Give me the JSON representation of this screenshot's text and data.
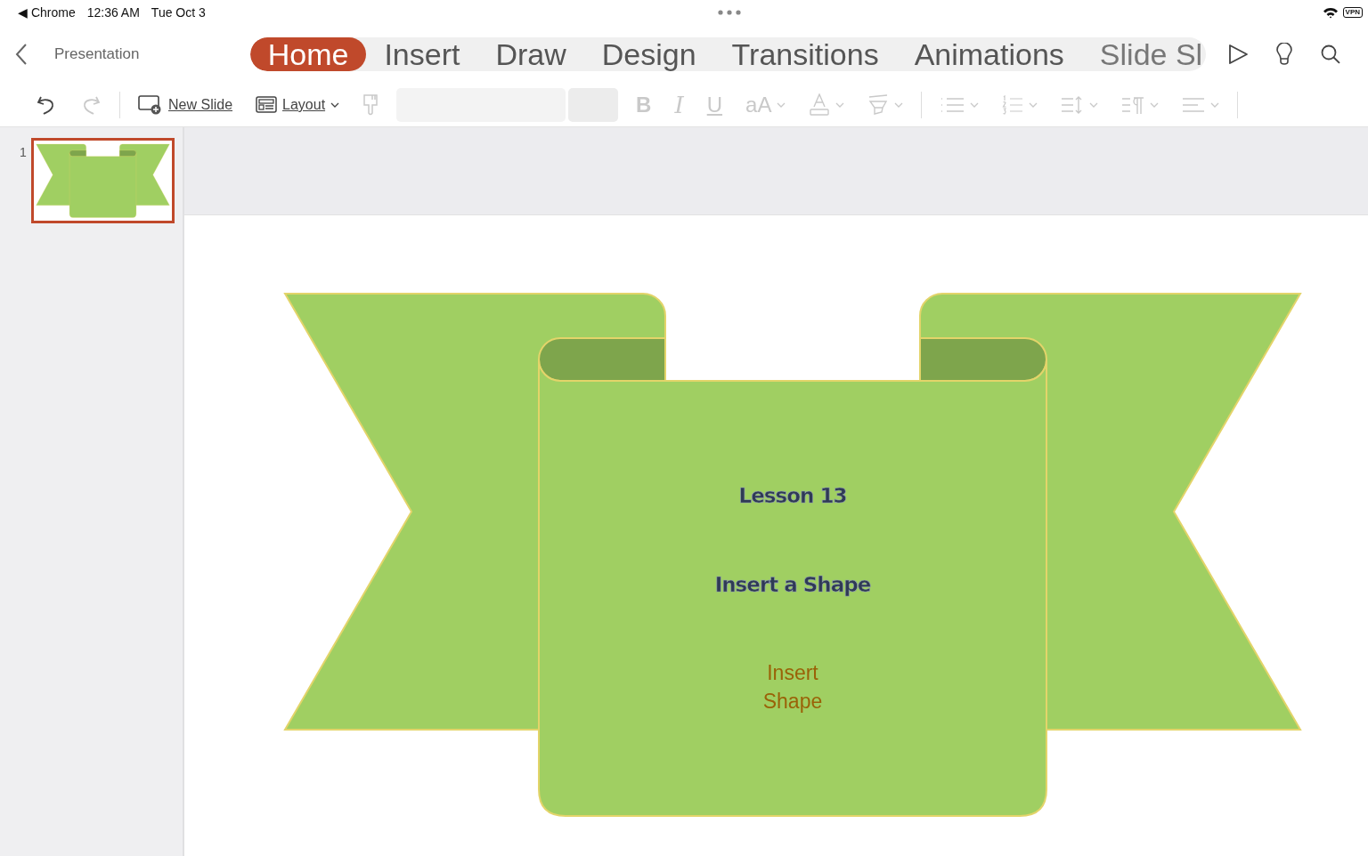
{
  "status_bar": {
    "back_app": "◀ Chrome",
    "time": "12:36 AM",
    "date": "Tue Oct 3",
    "vpn": "VPN"
  },
  "header": {
    "document_title": "Presentation"
  },
  "tabs": [
    {
      "label": "Home",
      "selected": true
    },
    {
      "label": "Insert",
      "selected": false
    },
    {
      "label": "Draw",
      "selected": false
    },
    {
      "label": "Design",
      "selected": false
    },
    {
      "label": "Transitions",
      "selected": false
    },
    {
      "label": "Animations",
      "selected": false
    },
    {
      "label": "Slide Sl",
      "selected": false
    }
  ],
  "toolbar": [
    {
      "kind": "undo",
      "disabled": false
    },
    {
      "kind": "redo",
      "disabled": true
    },
    {
      "kind": "divider"
    },
    {
      "kind": "new-slide",
      "label": "New Slide",
      "disabled": false
    },
    {
      "kind": "layout",
      "label": "Layout",
      "disabled": false,
      "dropdown": true
    },
    {
      "kind": "painter",
      "disabled": true
    },
    {
      "kind": "font-fields"
    },
    {
      "kind": "bold",
      "label": "B",
      "disabled": true
    },
    {
      "kind": "italic",
      "label": "I",
      "disabled": true
    },
    {
      "kind": "underline",
      "label": "U",
      "disabled": true
    },
    {
      "kind": "font-size",
      "label": "aA",
      "disabled": true,
      "dropdown": true
    },
    {
      "kind": "font-color",
      "disabled": true,
      "dropdown": true
    },
    {
      "kind": "highlight",
      "disabled": true,
      "dropdown": true
    },
    {
      "kind": "divider"
    },
    {
      "kind": "bullets",
      "disabled": true,
      "dropdown": true
    },
    {
      "kind": "numbering",
      "disabled": true,
      "dropdown": true
    },
    {
      "kind": "spacing",
      "disabled": true,
      "dropdown": true
    },
    {
      "kind": "paragraph",
      "disabled": true,
      "dropdown": true
    },
    {
      "kind": "align",
      "disabled": true,
      "dropdown": true
    },
    {
      "kind": "divider"
    }
  ],
  "slides": [
    {
      "number": "1",
      "selected": true
    }
  ],
  "slide": {
    "texts": [
      {
        "kind": "title",
        "text": "Lesson 13"
      },
      {
        "kind": "subtitle",
        "text": "Insert a Shape"
      },
      {
        "kind": "body",
        "text": "Insert Shape"
      }
    ]
  }
}
